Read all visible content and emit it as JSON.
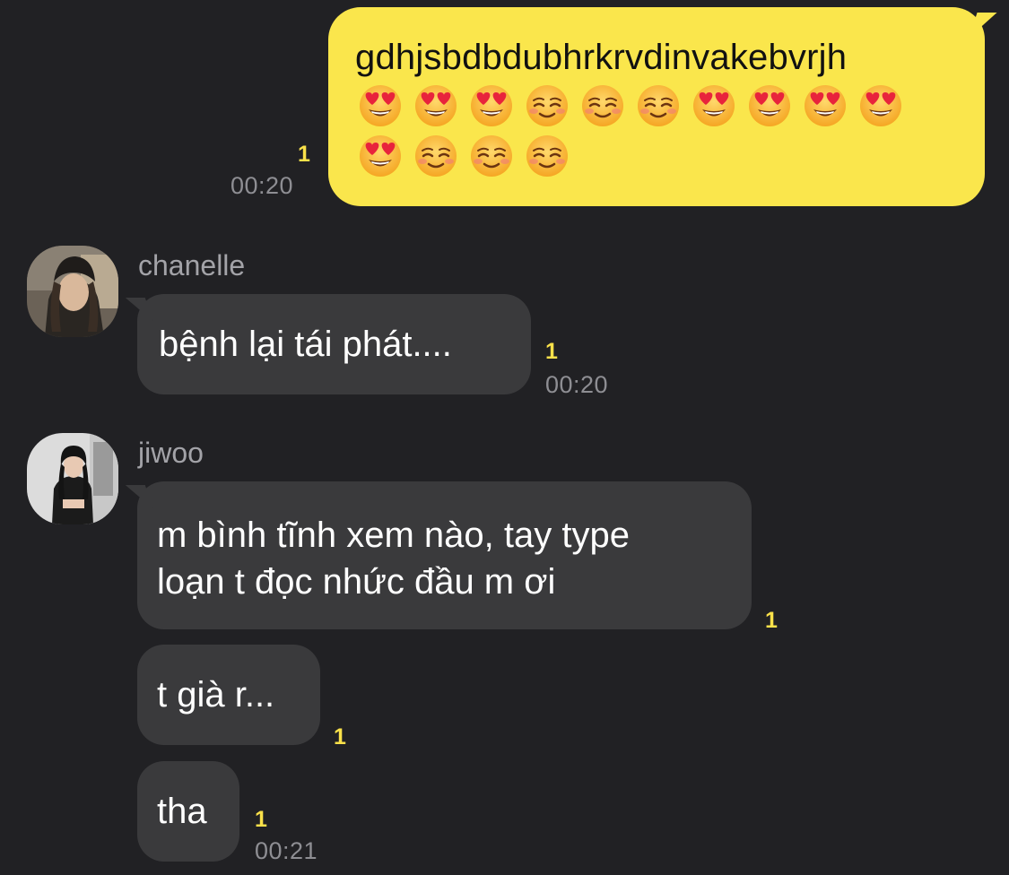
{
  "colors": {
    "background": "#212124",
    "outgoing_bubble": "#fae64c",
    "incoming_bubble": "#3a3a3c",
    "unread_count": "#fae14a",
    "timestamp": "#8e8e93"
  },
  "messages": {
    "outgoing": {
      "text": "gdhjsbdbdubhrkrvdinvakebvrjh",
      "emoji_rows": [
        [
          "heart-eyes-emoji",
          "heart-eyes-emoji",
          "heart-eyes-emoji",
          "smiling-blush-emoji",
          "smiling-blush-emoji",
          "smiling-blush-emoji",
          "heart-eyes-emoji",
          "heart-eyes-emoji",
          "heart-eyes-emoji",
          "heart-eyes-emoji"
        ],
        [
          "heart-eyes-emoji",
          "smiling-blush-emoji",
          "smiling-blush-emoji",
          "smiling-blush-emoji"
        ]
      ],
      "unread": "1",
      "time": "00:20"
    },
    "chanelle": {
      "sender": "chanelle",
      "avatar": "avatar-chanelle",
      "text": "bệnh lại tái phát....",
      "unread": "1",
      "time": "00:20"
    },
    "jiwoo": {
      "sender": "jiwoo",
      "avatar": "avatar-jiwoo",
      "msg1": {
        "line1": "m bình tĩnh xem nào, tay type",
        "line2": "loạn t đọc nhức đầu m ơi",
        "unread": "1"
      },
      "msg2": {
        "text": "t già r...",
        "unread": "1"
      },
      "msg3": {
        "text": "tha",
        "unread": "1",
        "time": "00:21"
      }
    }
  }
}
